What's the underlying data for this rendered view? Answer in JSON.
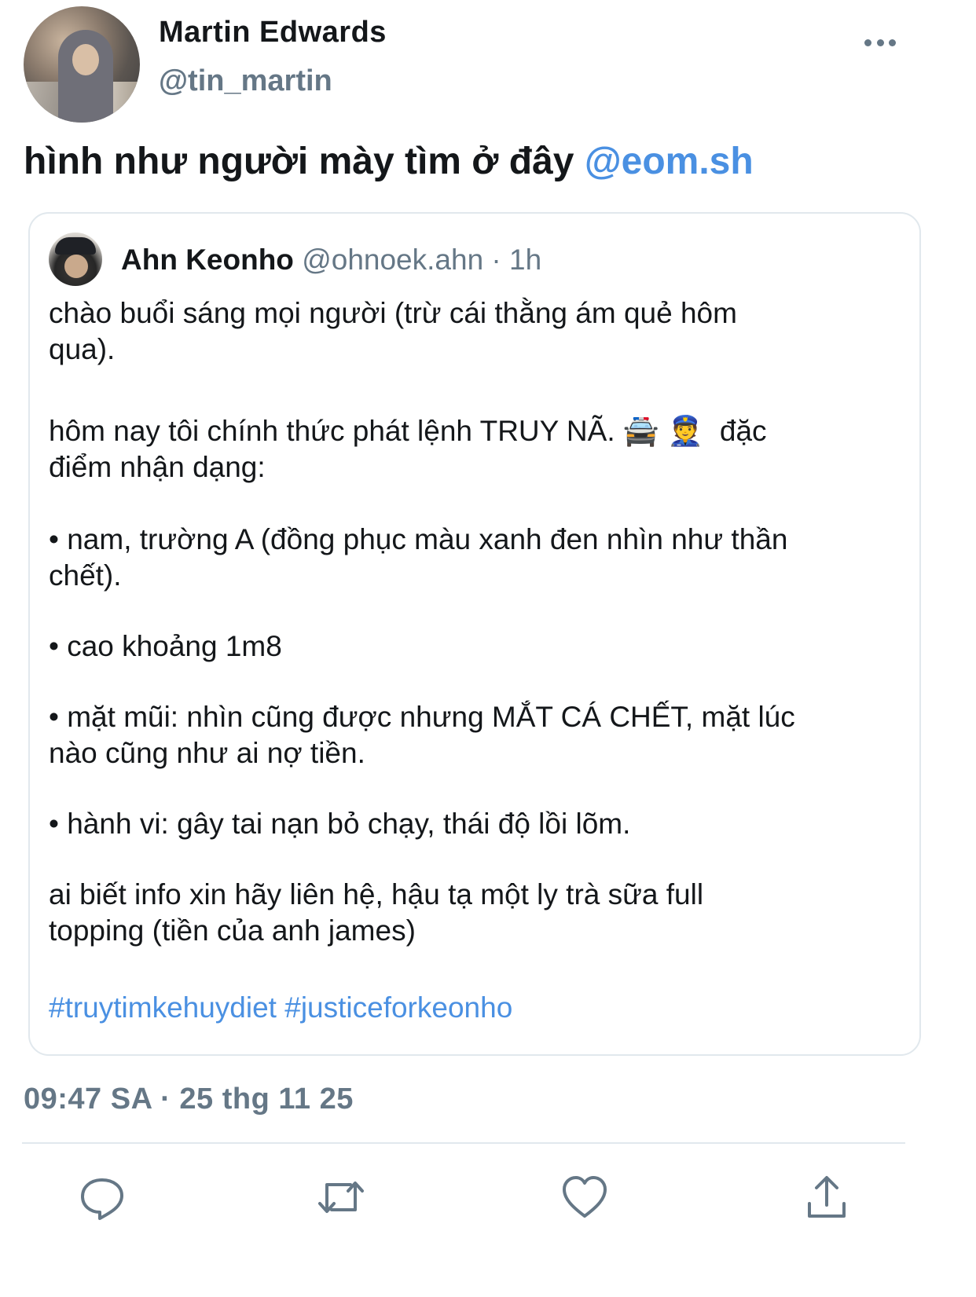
{
  "author": {
    "display_name": "Martin Edwards",
    "handle": "@tin_martin"
  },
  "tweet": {
    "text": "hình như người mày tìm ở đây ",
    "mention": "@eom.sh"
  },
  "quote": {
    "display_name": "Ahn Keonho",
    "meta": "@ohnoek.ahn · 1h",
    "paragraphs": [
      "chào buổi sáng mọi người (trừ cái thằng ám quẻ hôm\nqua).",
      "hôm nay tôi chính thức phát lệnh TRUY NÃ. 🚔 👮  đặc\nđiểm nhận dạng:",
      "• nam, trường A (đồng phục màu xanh đen nhìn như thần\nchết).",
      "• cao khoảng 1m8",
      "• mặt mũi: nhìn cũng được nhưng MẮT CÁ CHẾT, mặt lúc\nnào cũng như ai nợ tiền.",
      "• hành vi: gây tai nạn bỏ chạy, thái độ lồi lõm.",
      "ai biết info xin hãy liên hệ, hậu tạ một ly trà sữa full\ntopping (tiền của anh james)"
    ],
    "hashtags": "#truytimkehuydiet #justiceforkeonho"
  },
  "timestamp": "09:47 SA · 25 thg 11 25",
  "actions": {
    "reply_icon": "reply-icon",
    "retweet_icon": "retweet-icon",
    "like_icon": "heart-icon",
    "share_icon": "share-icon"
  },
  "colors": {
    "link": "#4a90e2",
    "secondary": "#657786",
    "border": "#e1e8ed"
  }
}
